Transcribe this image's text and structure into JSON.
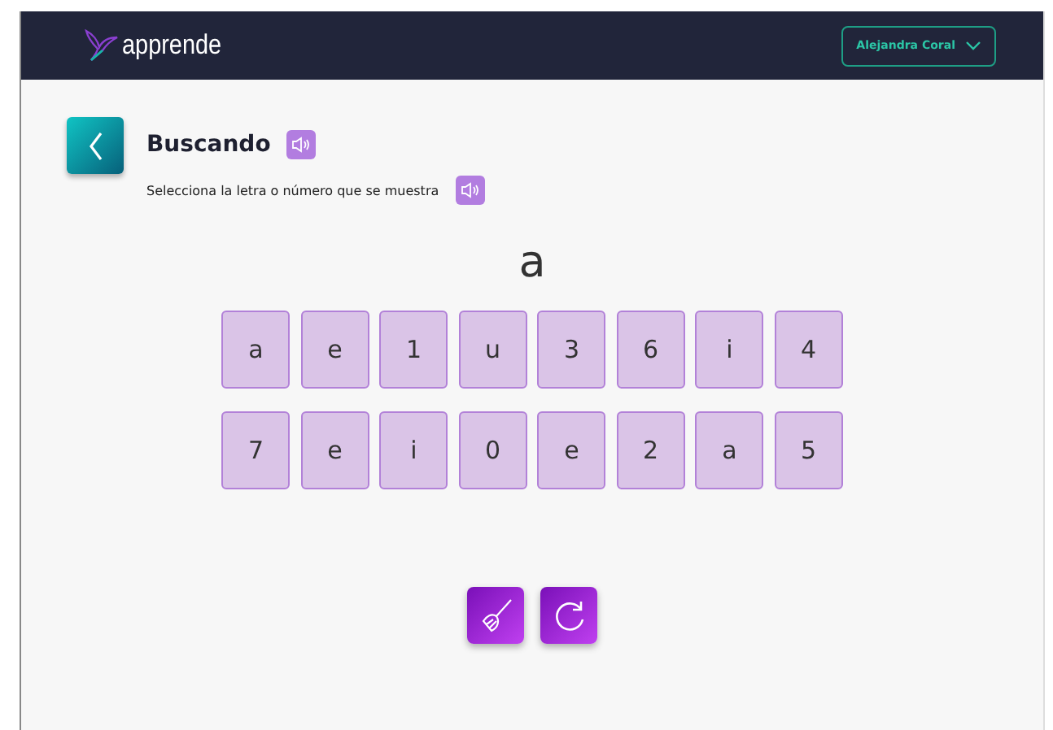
{
  "header": {
    "brand": "apprende",
    "user": "Alejandra Coral"
  },
  "title": "Buscando",
  "instruction": "Selecciona la letra o número que se muestra",
  "target": "a",
  "tiles": [
    [
      "a",
      "e",
      "1",
      "u",
      "3",
      "6",
      "i",
      "4"
    ],
    [
      "7",
      "e",
      "i",
      "0",
      "e",
      "2",
      "a",
      "5"
    ]
  ]
}
